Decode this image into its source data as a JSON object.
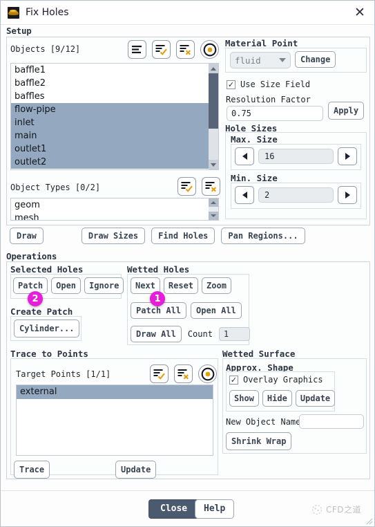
{
  "window": {
    "title": "Fix Holes",
    "icon": "mesh-icon",
    "close_label": "✕"
  },
  "setup": {
    "group_label": "Setup",
    "objects": {
      "label": "Objects [9/12]",
      "toolbar": [
        {
          "name": "list-all-icon"
        },
        {
          "name": "select-all-icon"
        },
        {
          "name": "deselect-all-icon"
        },
        {
          "name": "target-icon"
        }
      ],
      "items": [
        {
          "label": "baffle1",
          "selected": false
        },
        {
          "label": "baffle2",
          "selected": false
        },
        {
          "label": "baffles",
          "selected": false
        },
        {
          "label": "flow-pipe",
          "selected": true
        },
        {
          "label": "inlet",
          "selected": true
        },
        {
          "label": "main",
          "selected": true
        },
        {
          "label": "outlet1",
          "selected": true
        },
        {
          "label": "outlet2",
          "selected": true
        }
      ]
    },
    "object_types": {
      "label": "Object Types [0/2]",
      "toolbar": [
        {
          "name": "select-all-icon"
        },
        {
          "name": "deselect-all-icon"
        }
      ],
      "items": [
        {
          "label": "geom",
          "selected": false
        },
        {
          "label": "mesh",
          "selected": false
        }
      ]
    },
    "actions": [
      {
        "label": "Draw",
        "name": "draw-button"
      },
      {
        "label": "Draw Sizes",
        "name": "draw-sizes-button"
      },
      {
        "label": "Find Holes",
        "name": "find-holes-button"
      },
      {
        "label": "Pan Regions...",
        "name": "pan-regions-button"
      }
    ],
    "material_point": {
      "label": "Material Point",
      "value": "fluid",
      "change_label": "Change"
    },
    "use_size_field": {
      "label": "Use Size Field",
      "checked": true,
      "check_glyph": "✓"
    },
    "resolution_factor": {
      "label": "Resolution Factor",
      "value": "0.75",
      "apply_label": "Apply"
    },
    "hole_sizes": {
      "label": "Hole Sizes",
      "max": {
        "label": "Max. Size",
        "value": "16"
      },
      "min": {
        "label": "Min. Size",
        "value": "2"
      }
    }
  },
  "operations": {
    "group_label": "Operations",
    "selected_holes": {
      "label": "Selected Holes",
      "buttons": [
        {
          "label": "Patch",
          "name": "patch-button"
        },
        {
          "label": "Open",
          "name": "open-button"
        },
        {
          "label": "Ignore",
          "name": "ignore-button"
        }
      ]
    },
    "create_patch": {
      "label": "Create Patch",
      "buttons": [
        {
          "label": "Cylinder...",
          "name": "cylinder-button"
        }
      ]
    },
    "wetted_holes": {
      "label": "Wetted Holes",
      "row1": [
        {
          "label": "Next",
          "name": "next-button"
        },
        {
          "label": "Reset",
          "name": "reset-button"
        },
        {
          "label": "Zoom",
          "name": "zoom-button"
        }
      ],
      "row2": [
        {
          "label": "Patch All",
          "name": "patch-all-button"
        },
        {
          "label": "Open All",
          "name": "open-all-button"
        }
      ],
      "row3": [
        {
          "label": "Draw All",
          "name": "draw-all-button"
        }
      ],
      "count_label": "Count",
      "count_value": "1"
    },
    "badges": [
      {
        "text": "1",
        "color": "#e31fd8",
        "target": "patch-all-button"
      },
      {
        "text": "2",
        "color": "#e31fd8",
        "target": "patch-button"
      }
    ]
  },
  "trace_to_points": {
    "group_label": "Trace to Points",
    "target_points": {
      "label": "Target Points [1/1]",
      "toolbar": [
        {
          "name": "select-all-icon"
        },
        {
          "name": "deselect-all-icon"
        },
        {
          "name": "target-icon"
        }
      ],
      "items": [
        {
          "label": "external",
          "selected": true
        }
      ]
    },
    "buttons": [
      {
        "label": "Trace",
        "name": "trace-button"
      },
      {
        "label": "Update",
        "name": "update-button"
      }
    ]
  },
  "wetted_surface": {
    "group_label": "Wetted Surface",
    "approx_shape": {
      "label": "Approx. Shape",
      "overlay_graphics": {
        "label": "Overlay Graphics",
        "checked": true,
        "check_glyph": "✓"
      },
      "buttons": [
        {
          "label": "Show",
          "name": "show-button"
        },
        {
          "label": "Hide",
          "name": "hide-button"
        },
        {
          "label": "Update",
          "name": "update-shape-button"
        }
      ]
    },
    "new_object_name": {
      "label": "New Object Name",
      "value": "",
      "placeholder": ""
    },
    "shrink_wrap_label": "Shrink Wrap"
  },
  "footer": {
    "close_label": "Close",
    "help_label": "Help",
    "watermark_text": "CFD之道"
  },
  "colors": {
    "selection": "#94a8bf",
    "accent": "#e0a013",
    "badge": "#e31fd8",
    "primary_button": "#4c5a70"
  }
}
